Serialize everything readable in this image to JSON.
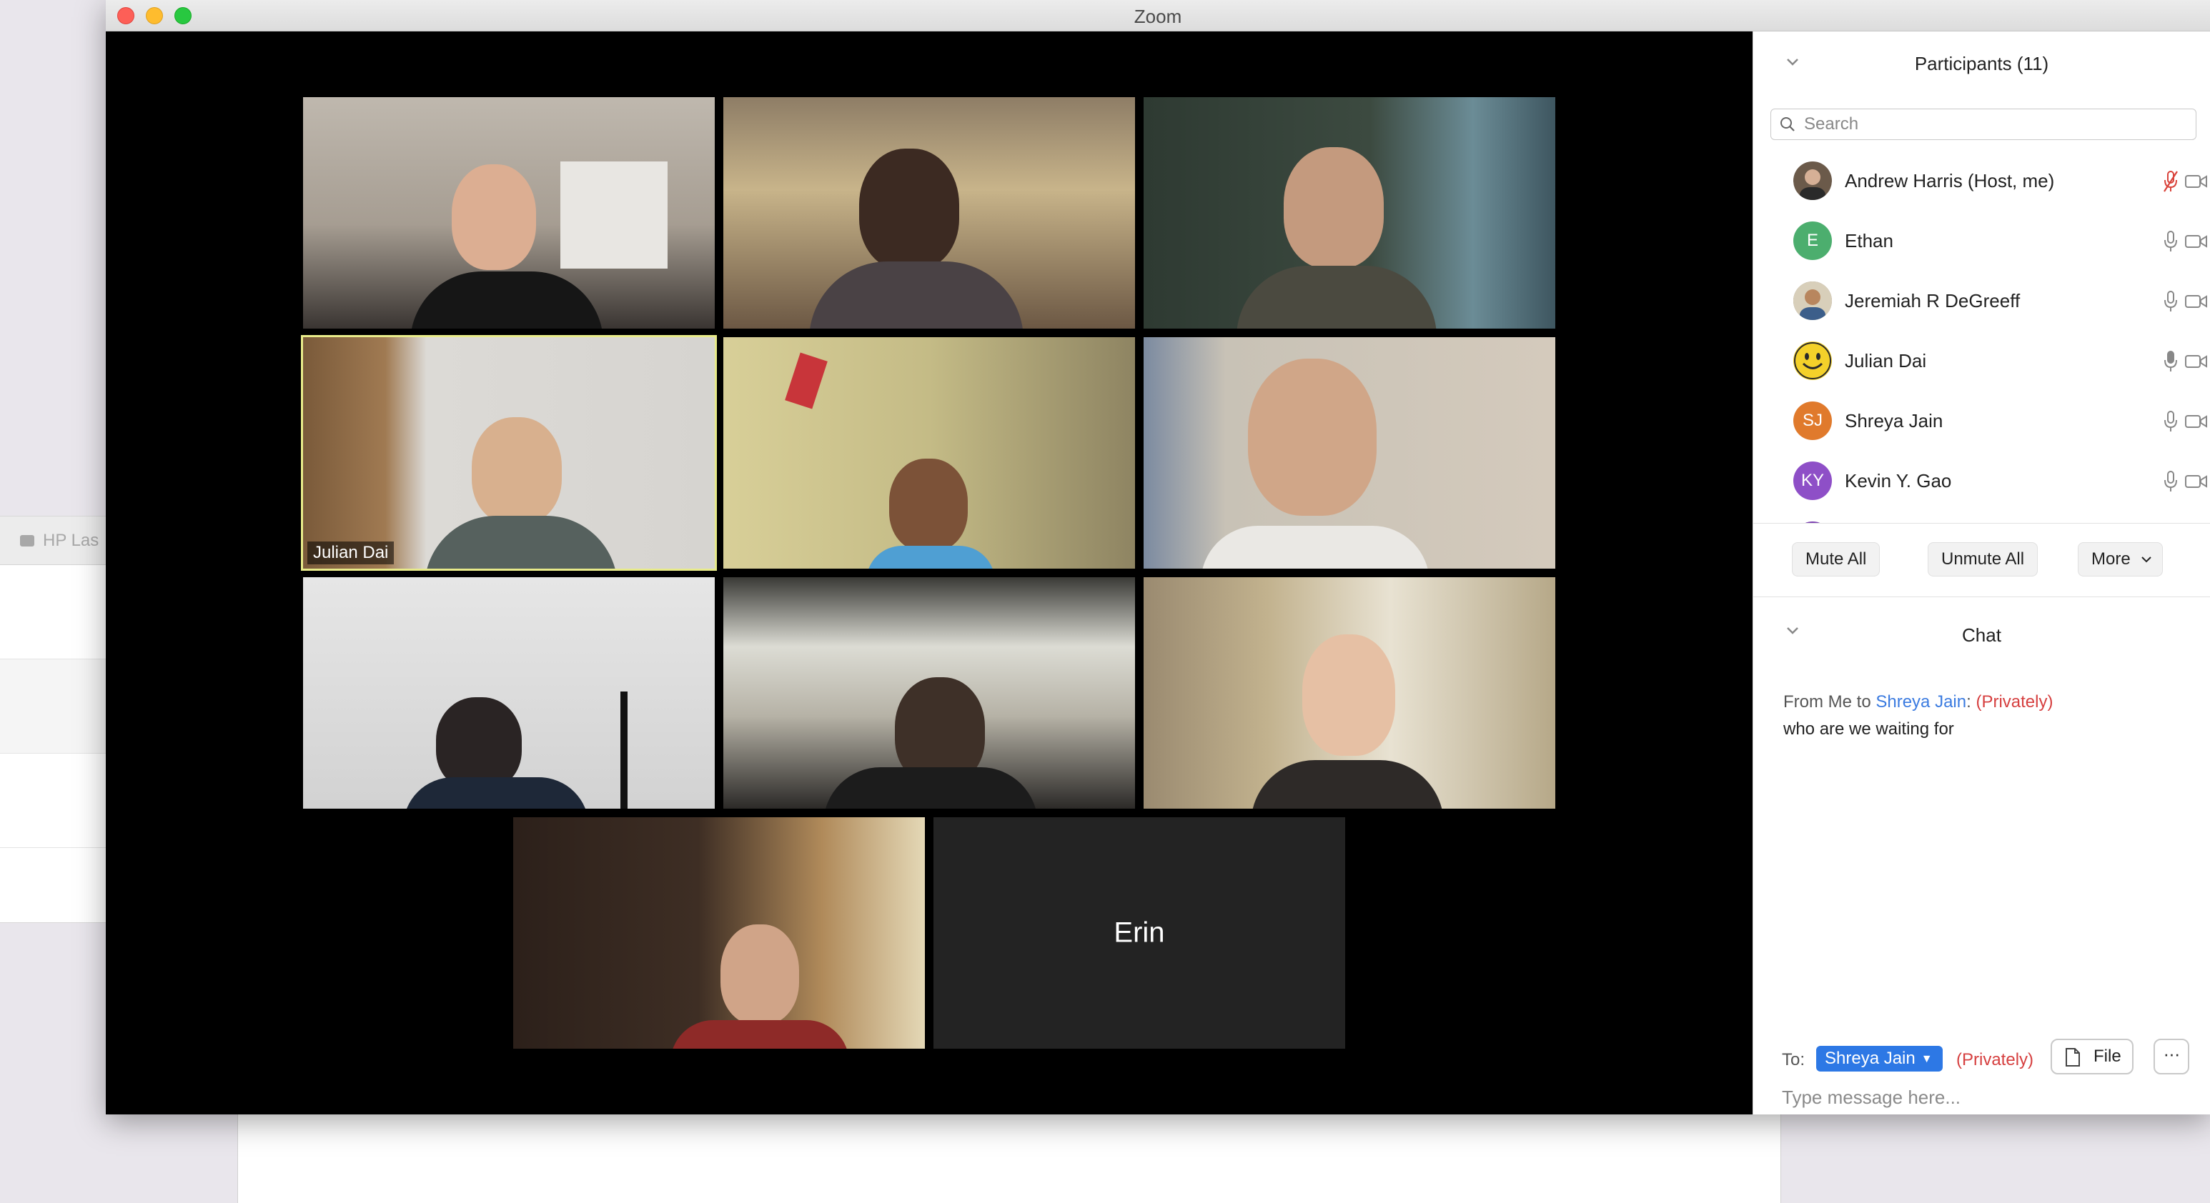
{
  "background": {
    "printer_window_title": "HP Las"
  },
  "window": {
    "title": "Zoom"
  },
  "gallery": {
    "active_speaker_label": "Julian Dai",
    "no_video_name": "Erin"
  },
  "participants": {
    "title": "Participants (11)",
    "search_placeholder": "Search",
    "items": [
      {
        "name": "Andrew Harris (Host, me)",
        "initials": "",
        "avatar_color": "#6b5a4a",
        "muted": true
      },
      {
        "name": "Ethan",
        "initials": "E",
        "avatar_color": "#4cae6e",
        "muted": false
      },
      {
        "name": "Jeremiah R DeGreeff",
        "initials": "",
        "avatar_color": "#8a7a60",
        "muted": false
      },
      {
        "name": "Julian Dai",
        "initials": "",
        "avatar_color": "#f4d12a",
        "muted": false
      },
      {
        "name": "Shreya Jain",
        "initials": "SJ",
        "avatar_color": "#e07a2c",
        "muted": false
      },
      {
        "name": "Kevin Y. Gao",
        "initials": "KY",
        "avatar_color": "#8e4fc7",
        "muted": false
      }
    ],
    "mute_all": "Mute All",
    "unmute_all": "Unmute All",
    "more": "More"
  },
  "chat": {
    "title": "Chat",
    "message": {
      "from_prefix": "From Me to ",
      "recipient": "Shreya Jain",
      "separator": ": ",
      "privacy": "(Privately)",
      "text": "who are we waiting for"
    },
    "to_label": "To:",
    "to_value": "Shreya Jain",
    "to_privacy": "(Privately)",
    "file_button": "File",
    "more_button": "···",
    "input_placeholder": "Type message here..."
  },
  "colors": {
    "accent_blue": "#2d78e5",
    "private_red": "#d64040",
    "active_speaker_border": "#e8eb8a",
    "muted_mic_red": "#d9433b"
  }
}
